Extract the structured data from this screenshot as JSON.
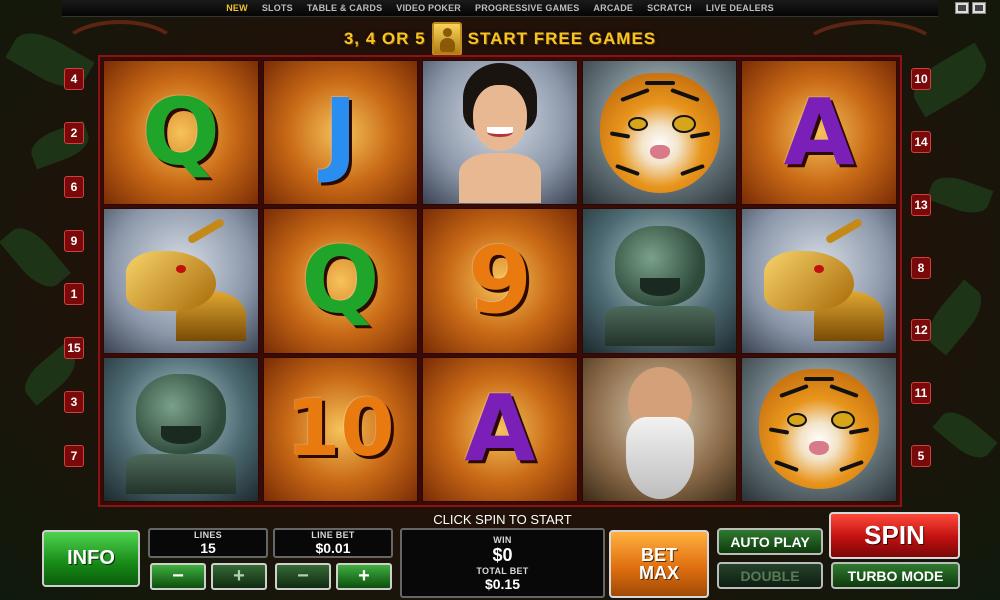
{
  "nav": {
    "items": [
      "NEW",
      "SLOTS",
      "TABLE & CARDS",
      "VIDEO POKER",
      "PROGRESSIVE GAMES",
      "ARCADE",
      "SCRATCH",
      "LIVE DEALERS"
    ],
    "active": "NEW"
  },
  "banner": {
    "left": "3, 4 OR 5",
    "right": "START FREE GAMES"
  },
  "reels": [
    [
      {
        "type": "Q",
        "color": "green"
      },
      {
        "type": "dragon"
      },
      {
        "type": "foo-dog"
      }
    ],
    [
      {
        "type": "J",
        "color": "blue"
      },
      {
        "type": "Q",
        "color": "green"
      },
      {
        "type": "10",
        "color": "orange"
      }
    ],
    [
      {
        "type": "lady"
      },
      {
        "type": "9",
        "color": "orange"
      },
      {
        "type": "A",
        "color": "purple"
      }
    ],
    [
      {
        "type": "tiger"
      },
      {
        "type": "foo-dog"
      },
      {
        "type": "monk"
      }
    ],
    [
      {
        "type": "A",
        "color": "purple"
      },
      {
        "type": "dragon"
      },
      {
        "type": "tiger"
      }
    ]
  ],
  "paylines_left": [
    "4",
    "2",
    "6",
    "9",
    "1",
    "15",
    "3",
    "7"
  ],
  "paylines_right": [
    "10",
    "14",
    "13",
    "8",
    "12",
    "11",
    "5"
  ],
  "controls": {
    "info": "INFO",
    "lines_label": "LINES",
    "lines_value": "15",
    "linebet_label": "LINE BET",
    "linebet_value": "$0.01",
    "minus": "−",
    "plus": "+",
    "status": "CLICK SPIN TO START",
    "win_label": "WIN",
    "win_value": "$0",
    "totalbet_label": "TOTAL BET",
    "totalbet_value": "$0.15",
    "betmax_line1": "BET",
    "betmax_line2": "MAX",
    "autoplay": "AUTO PLAY",
    "double": "DOUBLE",
    "spin": "SPIN",
    "turbo": "TURBO MODE"
  },
  "colors": {
    "green": "#1fa52a",
    "blue": "#2a8ef0",
    "purple": "#7a1fb8",
    "orange": "#e87a10",
    "banner": "#f5c526"
  }
}
